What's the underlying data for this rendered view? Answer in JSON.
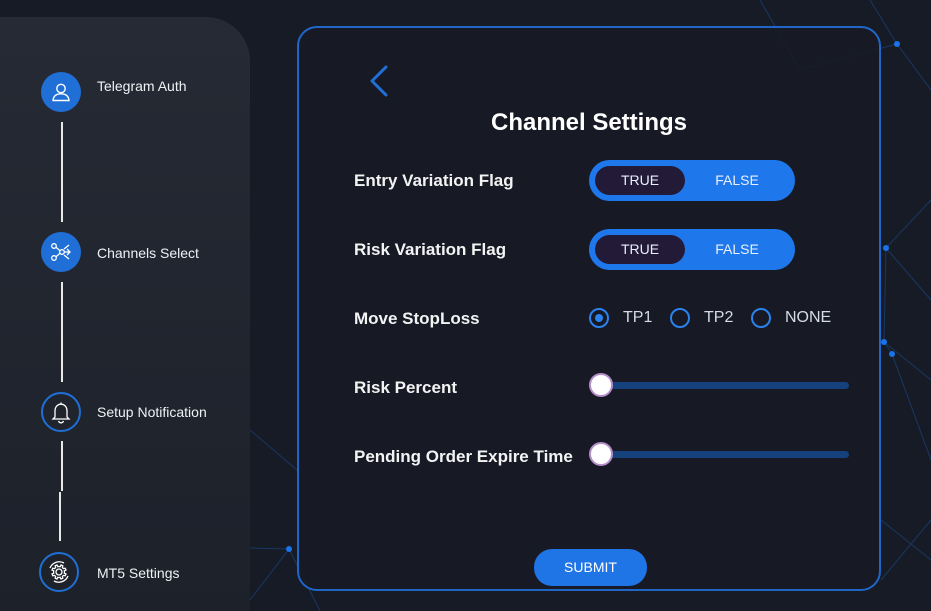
{
  "sidebar": {
    "steps": [
      {
        "label": "Telegram Auth",
        "icon": "user-icon"
      },
      {
        "label": "Channels Select",
        "icon": "share-icon"
      },
      {
        "label": "Setup Notification",
        "icon": "bell-icon"
      },
      {
        "label": "MT5 Settings",
        "icon": "gear-icon"
      }
    ]
  },
  "panel": {
    "back_icon": "chevron-left-icon",
    "title": "Channel Settings",
    "entry_variation": {
      "label": "Entry Variation Flag",
      "true_label": "TRUE",
      "false_label": "FALSE",
      "selected": "TRUE"
    },
    "risk_variation": {
      "label": "Risk Variation Flag",
      "true_label": "TRUE",
      "false_label": "FALSE",
      "selected": "TRUE"
    },
    "move_stoploss": {
      "label": "Move StopLoss",
      "options": [
        "TP1",
        "TP2",
        "NONE"
      ],
      "selected": "TP1"
    },
    "risk_percent": {
      "label": "Risk Percent",
      "value": 0
    },
    "pending_expire": {
      "label": "Pending Order Expire Time",
      "value": 0
    },
    "submit_label": "SUBMIT"
  },
  "colors": {
    "accent": "#1e78ec",
    "background": "#171b26",
    "sidebar": "#262a34",
    "toggle_selected": "#221a37"
  }
}
